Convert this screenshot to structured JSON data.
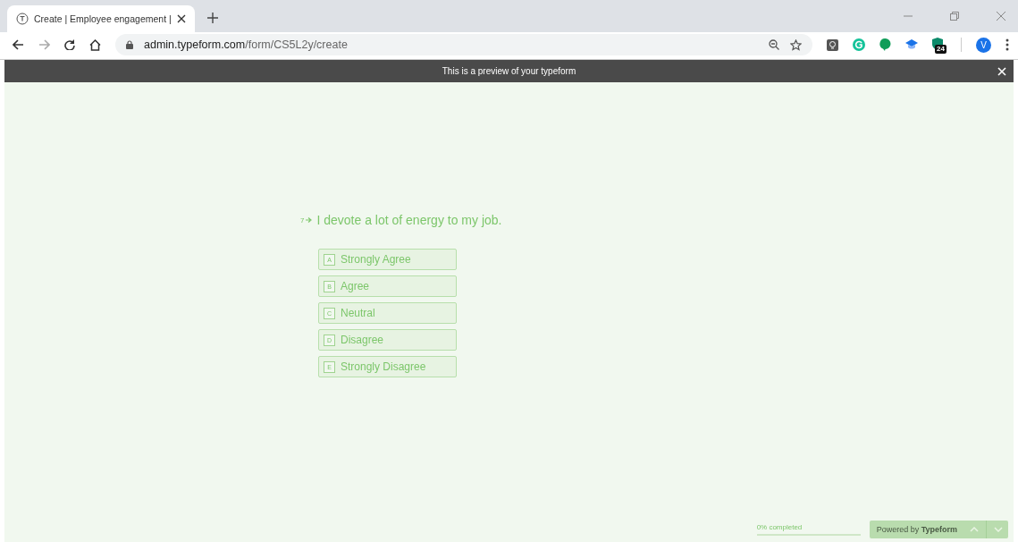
{
  "browser": {
    "tab": {
      "title": "Create | Employee engagement |",
      "selected": true
    },
    "address": {
      "domain": "admin.typeform.com",
      "path": "/form/CS5L2y/create"
    },
    "extension_badge": "24",
    "profile_initial": "V"
  },
  "preview_banner": {
    "text": "This is a preview of your typeform"
  },
  "question": {
    "number": "7",
    "text": "I devote a lot of energy to my job.",
    "choices": [
      {
        "key": "A",
        "label": "Strongly Agree",
        "selected": false
      },
      {
        "key": "B",
        "label": "Agree",
        "selected": false
      },
      {
        "key": "C",
        "label": "Neutral",
        "selected": false
      },
      {
        "key": "D",
        "label": "Disagree",
        "selected": false
      },
      {
        "key": "E",
        "label": "Strongly Disagree",
        "selected": false
      }
    ]
  },
  "progress": {
    "label": "0% completed",
    "level": 0
  },
  "branding": {
    "text": "Powered by **Typeform**"
  }
}
